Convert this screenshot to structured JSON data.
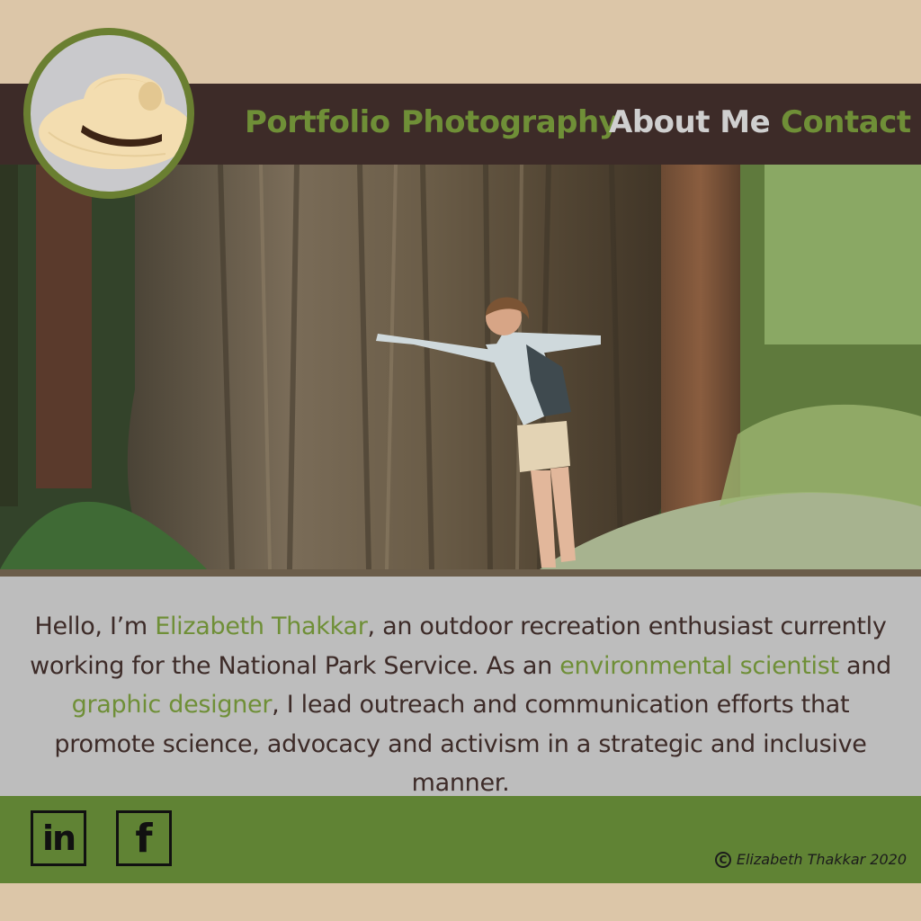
{
  "nav": {
    "items": [
      {
        "label": "Portfolio",
        "active": false
      },
      {
        "label": "Photography",
        "active": false
      },
      {
        "label": "About Me",
        "active": true
      },
      {
        "label": "Contact",
        "active": false
      }
    ]
  },
  "logo": {
    "icon": "hat-icon"
  },
  "hero": {
    "image": "woman-hugging-redwood-tree-photo"
  },
  "about": {
    "p1": "Hello, I’m ",
    "name": "Elizabeth Thakkar",
    "p2": ", an outdoor recreation enthusiast currently working for the National Park Service. As an ",
    "role1": "environmental scientist",
    "p3": " and ",
    "role2": "graphic designer",
    "p4": ", I lead outreach and communication efforts that promote science, advocacy and activism in a strategic and inclusive manner."
  },
  "footer": {
    "social": [
      {
        "label": "in",
        "icon": "linkedin-icon"
      },
      {
        "label": "f",
        "icon": "facebook-icon"
      }
    ],
    "copyright_symbol": "C",
    "copyright": "Elizabeth Thakkar 2020"
  },
  "colors": {
    "accent_green": "#6f8f37",
    "nav_brown": "#3d2b28",
    "tan": "#dcc6a8",
    "footer_green": "#608334",
    "about_gray": "#bdbdbd"
  }
}
